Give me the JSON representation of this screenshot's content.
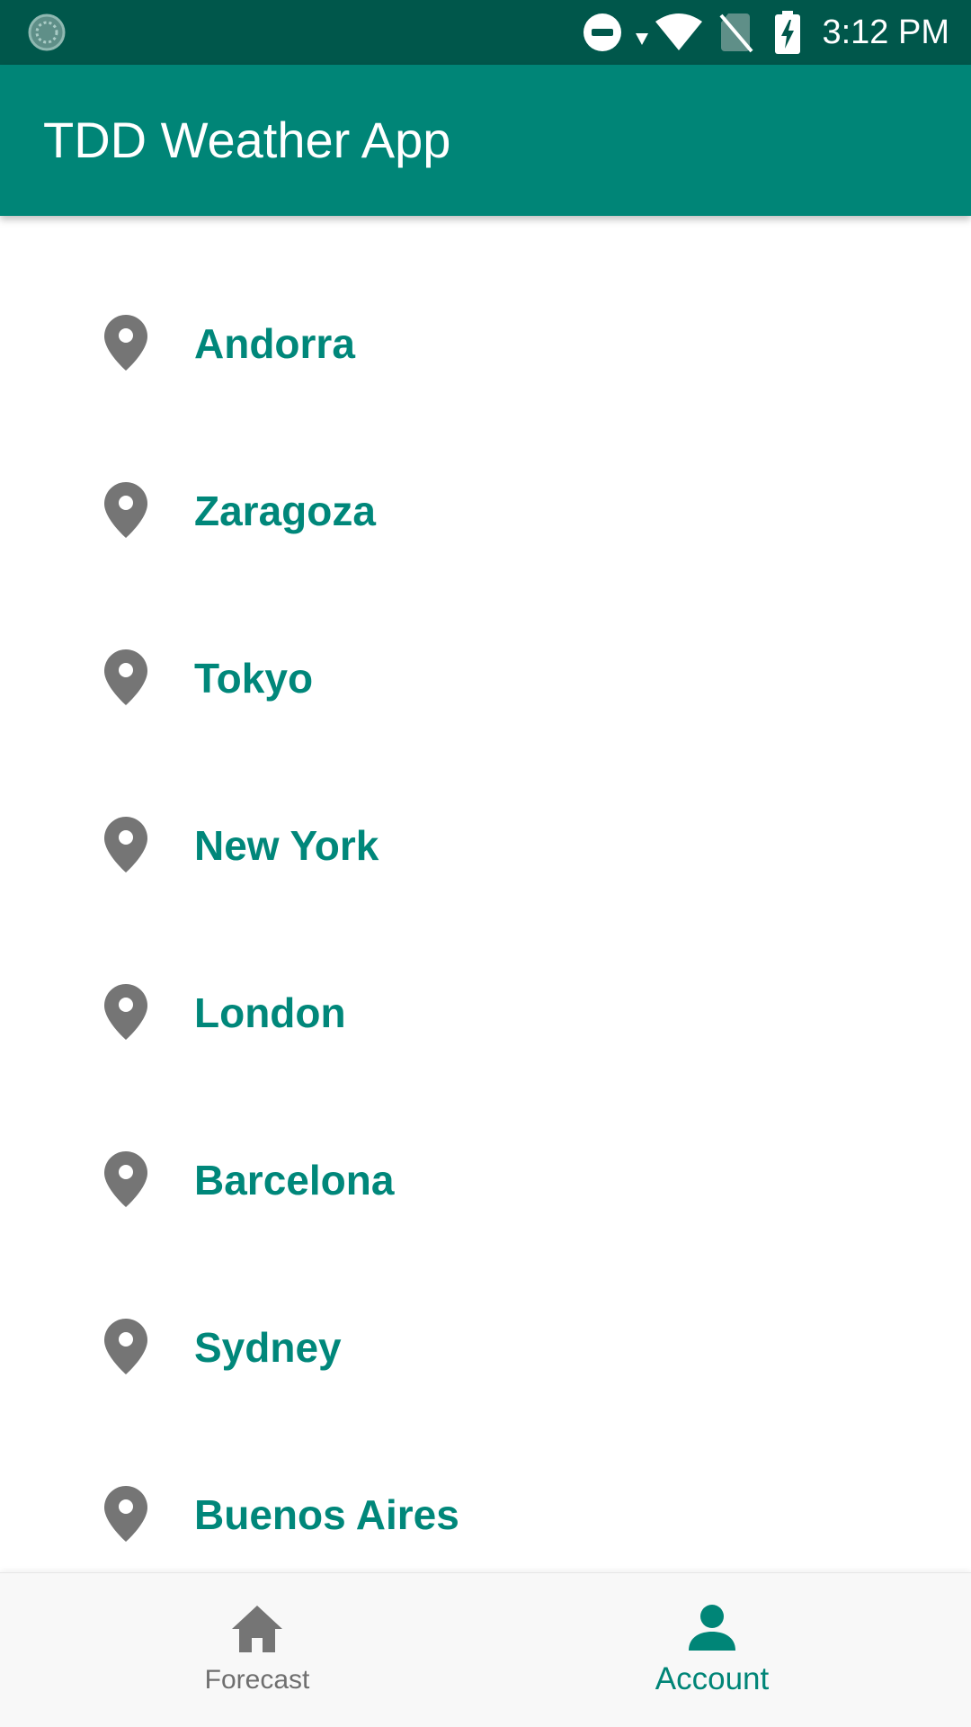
{
  "status_bar": {
    "time": "3:12 PM",
    "background_color": "#00574b",
    "icons": [
      "sync-icon",
      "do-not-disturb-icon",
      "data-arrow-icon",
      "wifi-icon",
      "no-sim-icon",
      "battery-charging-icon"
    ]
  },
  "app_bar": {
    "title": "TDD Weather App",
    "background_color": "#008577"
  },
  "city_list": {
    "item_icon": "location-pin-icon",
    "text_color": "#00877a",
    "items": [
      {
        "name": "Andorra"
      },
      {
        "name": "Zaragoza"
      },
      {
        "name": "Tokyo"
      },
      {
        "name": "New York"
      },
      {
        "name": "London"
      },
      {
        "name": "Barcelona"
      },
      {
        "name": "Sydney"
      },
      {
        "name": "Buenos Aires"
      }
    ]
  },
  "bottom_nav": {
    "items": [
      {
        "label": "Forecast",
        "icon": "home-icon",
        "selected": false
      },
      {
        "label": "Account",
        "icon": "person-icon",
        "selected": true
      }
    ],
    "active_color": "#008577",
    "inactive_color": "#6f6f6f"
  }
}
